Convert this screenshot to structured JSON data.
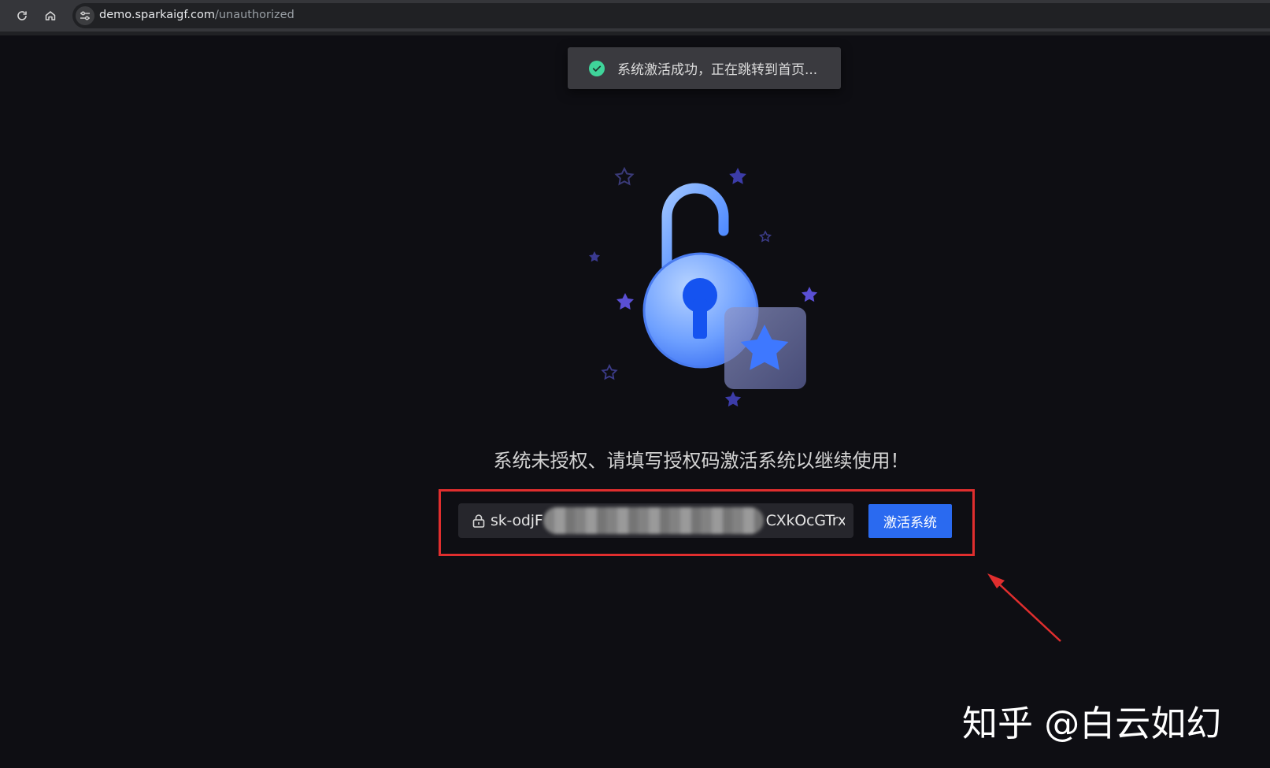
{
  "browser": {
    "url_host": "demo.sparkaigf.com",
    "url_path": "/unauthorized"
  },
  "toast": {
    "message": "系统激活成功，正在跳转到首页..."
  },
  "main": {
    "prompt": "系统未授权、请填写授权码激活系统以继续使用！",
    "license_input_value": "sk-odjF",
    "license_input_value_tail": "CXkOcGTrxY",
    "activate_button_label": "激活系统"
  },
  "watermark": {
    "text": "知乎 @白云如幻"
  },
  "colors": {
    "background": "#0e0e13",
    "accent": "#2a6af0",
    "success": "#3fd49a",
    "highlight_border": "#e02e2e"
  },
  "icons": {
    "reload": "reload-icon",
    "home": "home-icon",
    "site_info": "site-settings-icon",
    "toast": "check-circle-icon",
    "input": "lock-icon",
    "illustration": "unlocked-padlock-icon"
  }
}
